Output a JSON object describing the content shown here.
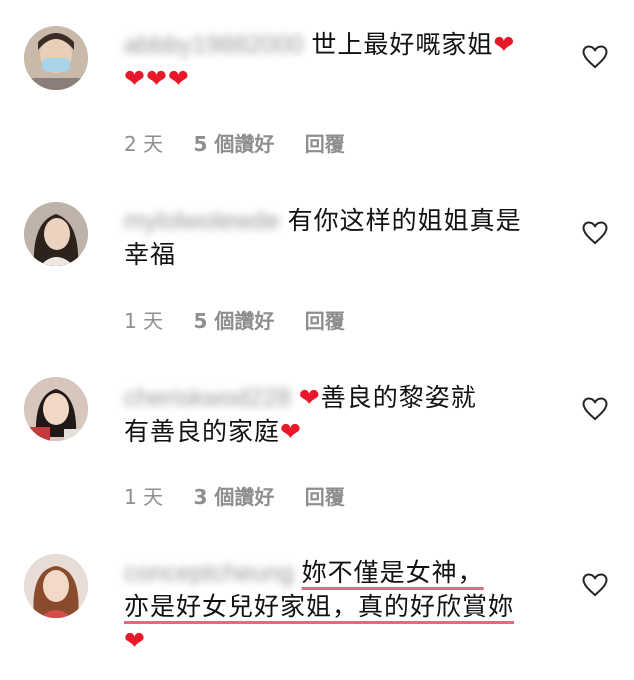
{
  "comments": [
    {
      "username": "abbby19882000",
      "text": "世上最好嘅家姐",
      "emoji_after": "❤",
      "line2": "❤❤❤",
      "time": "2 天",
      "likes": "5 個讚好",
      "reply": "回覆"
    },
    {
      "username": "mylolwolewde",
      "text1": "有你这样的姐姐真是",
      "text2": "幸福",
      "time": "1 天",
      "likes": "5 個讚好",
      "reply": "回覆"
    },
    {
      "username": "cheriskwod228",
      "emoji_before": "❤",
      "text1": "善良的黎姿就",
      "text2": "有善良的家庭",
      "emoji_after": "❤",
      "time": "1 天",
      "likes": "3 個讚好",
      "reply": "回覆"
    },
    {
      "username": "conceptcheung",
      "text1": "妳不僅是女神，",
      "text2": "亦是好女兒好家姐，真的好欣賞妳",
      "emoji": "❤"
    }
  ],
  "colors": {
    "heart": "#e8182a",
    "meta": "#8e8e8e",
    "highlight_underline": "#e06b7e"
  },
  "icons": [
    "heart-outline-icon"
  ]
}
